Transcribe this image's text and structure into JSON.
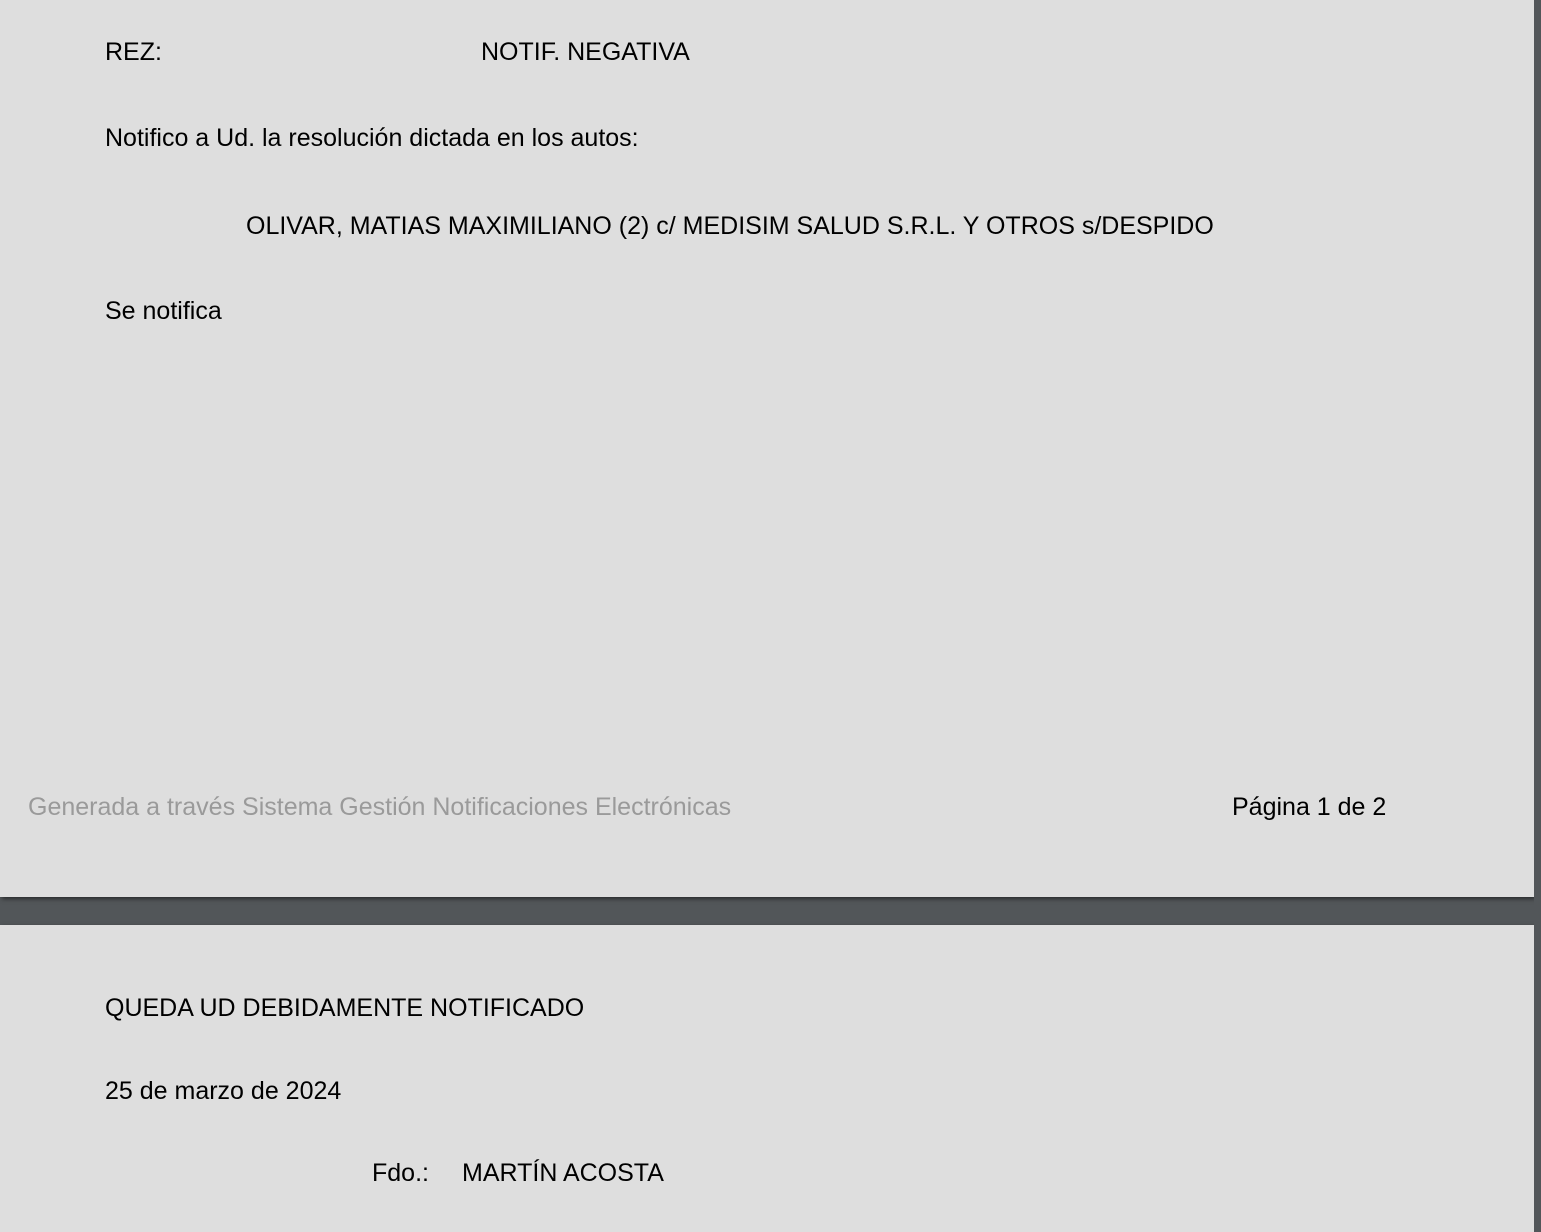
{
  "page1": {
    "rez_label": "REZ:",
    "rez_value": "NOTIF. NEGATIVA",
    "intro": "Notifico a Ud. la resolución dictada en los autos:",
    "case_title": "OLIVAR, MATIAS MAXIMILIANO (2) c/ MEDISIM SALUD S.R.L. Y OTROS s/DESPIDO",
    "body": "Se notifica",
    "footer_source": "Generada a través Sistema Gestión Notificaciones Electrónicas",
    "footer_page": "Página 1 de 2"
  },
  "page2": {
    "closing": "QUEDA UD DEBIDAMENTE NOTIFICADO",
    "date": "25 de marzo de 2024",
    "signed_label": "Fdo.:",
    "signed_name": "MARTÍN ACOSTA"
  },
  "colors": {
    "page_bg": "#dedede",
    "viewer_bg": "#525659",
    "footer_text": "#9a9a9a"
  }
}
